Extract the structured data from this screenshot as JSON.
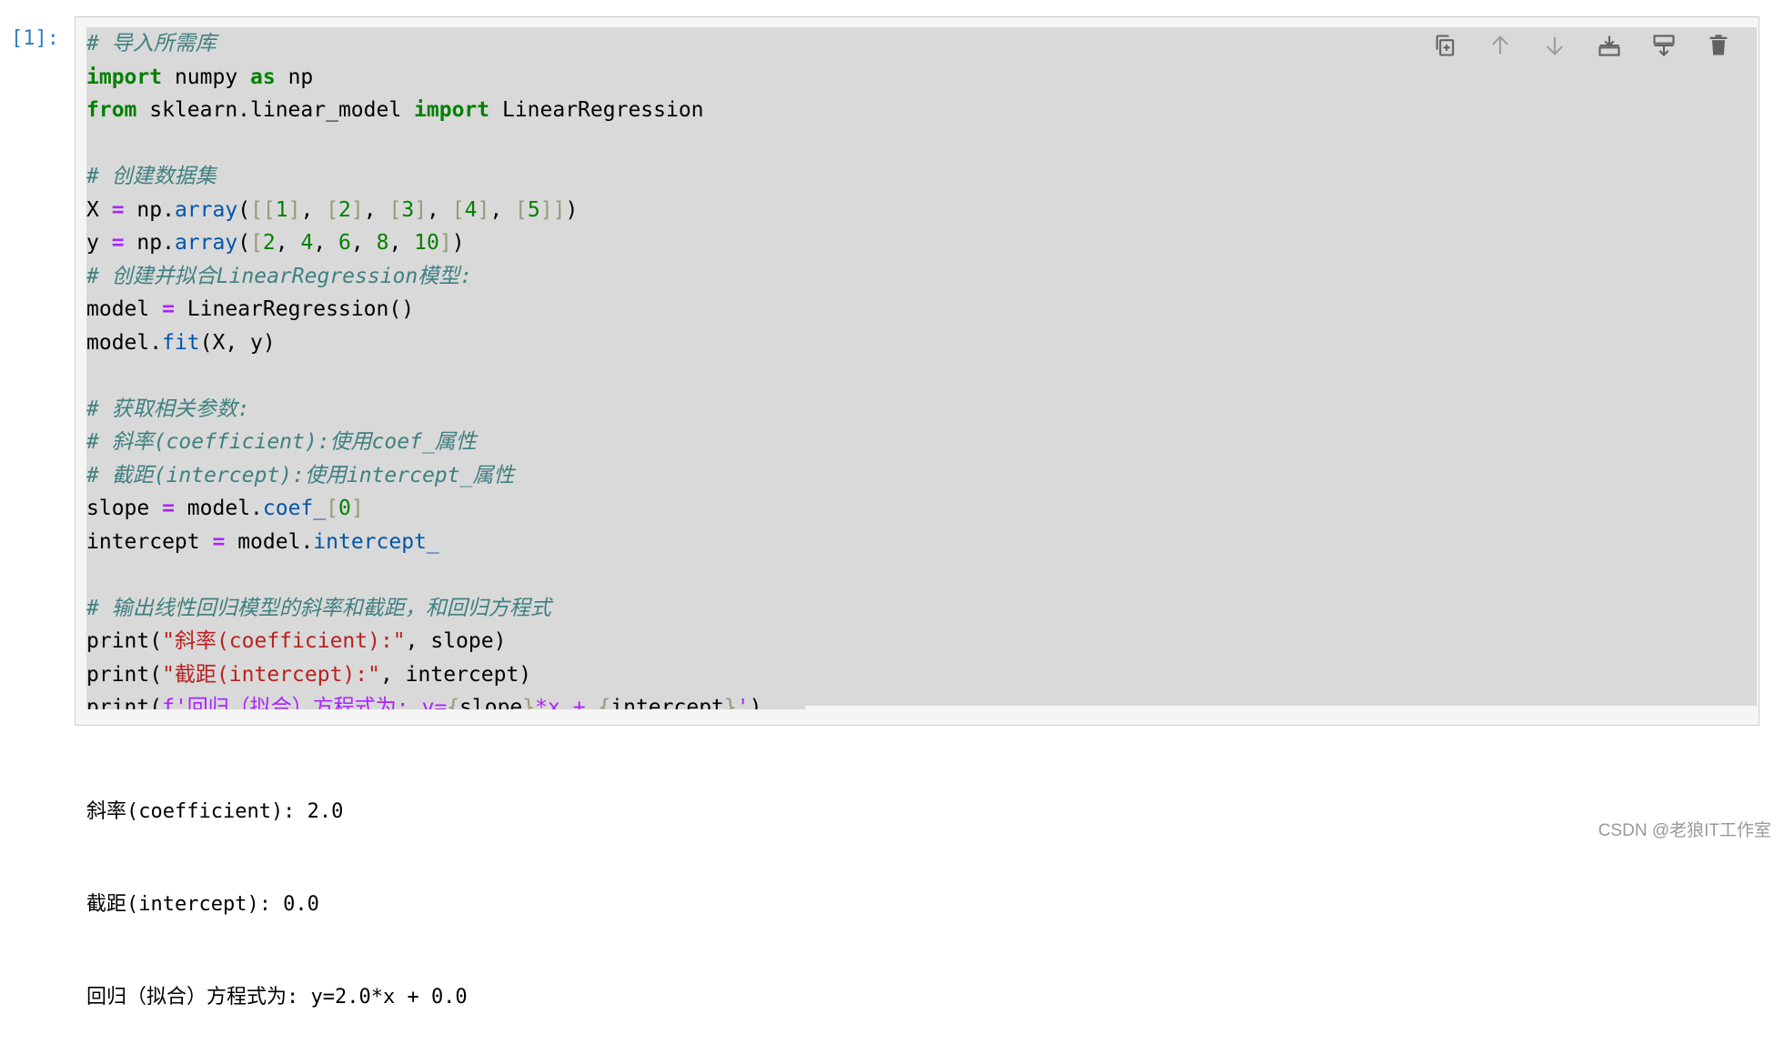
{
  "cell": {
    "prompt": "[1]:",
    "code_lines": [
      [
        {
          "t": "# 导入所需库",
          "c": "cm"
        }
      ],
      [
        {
          "t": "import",
          "c": "kw"
        },
        {
          "t": " numpy "
        },
        {
          "t": "as",
          "c": "kw"
        },
        {
          "t": " np"
        }
      ],
      [
        {
          "t": "from",
          "c": "kw"
        },
        {
          "t": " sklearn.linear_model "
        },
        {
          "t": "import",
          "c": "kw"
        },
        {
          "t": " LinearRegression"
        }
      ],
      [],
      [
        {
          "t": "# 创建数据集",
          "c": "cm"
        }
      ],
      [
        {
          "t": "X "
        },
        {
          "t": "=",
          "c": "op"
        },
        {
          "t": " np."
        },
        {
          "t": "array",
          "c": "at"
        },
        {
          "t": "("
        },
        {
          "t": "[[",
          "c": "br"
        },
        {
          "t": "1",
          "c": "nm"
        },
        {
          "t": "]",
          "c": "br"
        },
        {
          "t": ", "
        },
        {
          "t": "[",
          "c": "br"
        },
        {
          "t": "2",
          "c": "nm"
        },
        {
          "t": "]",
          "c": "br"
        },
        {
          "t": ", "
        },
        {
          "t": "[",
          "c": "br"
        },
        {
          "t": "3",
          "c": "nm"
        },
        {
          "t": "]",
          "c": "br"
        },
        {
          "t": ", "
        },
        {
          "t": "[",
          "c": "br"
        },
        {
          "t": "4",
          "c": "nm"
        },
        {
          "t": "]",
          "c": "br"
        },
        {
          "t": ", "
        },
        {
          "t": "[",
          "c": "br"
        },
        {
          "t": "5",
          "c": "nm"
        },
        {
          "t": "]]",
          "c": "br"
        },
        {
          "t": ")"
        }
      ],
      [
        {
          "t": "y "
        },
        {
          "t": "=",
          "c": "op"
        },
        {
          "t": " np."
        },
        {
          "t": "array",
          "c": "at"
        },
        {
          "t": "("
        },
        {
          "t": "[",
          "c": "br"
        },
        {
          "t": "2",
          "c": "nm"
        },
        {
          "t": ", "
        },
        {
          "t": "4",
          "c": "nm"
        },
        {
          "t": ", "
        },
        {
          "t": "6",
          "c": "nm"
        },
        {
          "t": ", "
        },
        {
          "t": "8",
          "c": "nm"
        },
        {
          "t": ", "
        },
        {
          "t": "10",
          "c": "nm"
        },
        {
          "t": "]",
          "c": "br"
        },
        {
          "t": ")"
        }
      ],
      [
        {
          "t": "# 创建并拟合LinearRegression模型:",
          "c": "cm"
        }
      ],
      [
        {
          "t": "model "
        },
        {
          "t": "=",
          "c": "op"
        },
        {
          "t": " LinearRegression()"
        }
      ],
      [
        {
          "t": "model."
        },
        {
          "t": "fit",
          "c": "at"
        },
        {
          "t": "(X, y)"
        }
      ],
      [],
      [
        {
          "t": "# 获取相关参数:",
          "c": "cm"
        }
      ],
      [
        {
          "t": "# 斜率(coefficient):使用coef_属性",
          "c": "cm"
        }
      ],
      [
        {
          "t": "# 截距(intercept):使用intercept_属性",
          "c": "cm"
        }
      ],
      [
        {
          "t": "slope "
        },
        {
          "t": "=",
          "c": "op"
        },
        {
          "t": " model."
        },
        {
          "t": "coef_",
          "c": "at"
        },
        {
          "t": "[",
          "c": "br"
        },
        {
          "t": "0",
          "c": "nm"
        },
        {
          "t": "]",
          "c": "br"
        }
      ],
      [
        {
          "t": "intercept "
        },
        {
          "t": "=",
          "c": "op"
        },
        {
          "t": " model."
        },
        {
          "t": "intercept_",
          "c": "at"
        }
      ],
      [],
      [
        {
          "t": "# 输出线性回归模型的斜率和截距，和回归方程式",
          "c": "cm"
        }
      ],
      [
        {
          "t": "print("
        },
        {
          "t": "\"斜率(coefficient):\"",
          "c": "st"
        },
        {
          "t": ", slope)"
        }
      ],
      [
        {
          "t": "print("
        },
        {
          "t": "\"截距(intercept):\"",
          "c": "st"
        },
        {
          "t": ", intercept)"
        }
      ],
      [
        {
          "t": "print("
        },
        {
          "t": "f'回归（拟合）方程式为: y=",
          "c": "ie"
        },
        {
          "t": "{",
          "c": "br"
        },
        {
          "t": "slope"
        },
        {
          "t": "}",
          "c": "br"
        },
        {
          "t": "*x + ",
          "c": "ie"
        },
        {
          "t": "{",
          "c": "br"
        },
        {
          "t": "intercept"
        },
        {
          "t": "}",
          "c": "br"
        },
        {
          "t": "'",
          "c": "ie"
        },
        {
          "t": ")"
        }
      ]
    ]
  },
  "toolbar": [
    {
      "name": "duplicate-cell-button",
      "icon": "copy-icon"
    },
    {
      "name": "move-up-button",
      "icon": "arrow-up-icon"
    },
    {
      "name": "move-down-button",
      "icon": "arrow-down-icon"
    },
    {
      "name": "insert-above-button",
      "icon": "insert-above-icon"
    },
    {
      "name": "insert-below-button",
      "icon": "insert-below-icon"
    },
    {
      "name": "delete-cell-button",
      "icon": "trash-icon"
    }
  ],
  "output": {
    "lines": [
      "斜率(coefficient): 2.0",
      "截距(intercept): 0.0",
      "回归（拟合）方程式为: y=2.0*x + 0.0"
    ]
  },
  "watermark": "CSDN @老狼IT工作室",
  "colors": {
    "prompt": "#307fc1",
    "keyword": "#008000",
    "comment": "#408080",
    "operator": "#aa22ff",
    "string": "#ba2121",
    "code_background": "#d9d9d9"
  }
}
